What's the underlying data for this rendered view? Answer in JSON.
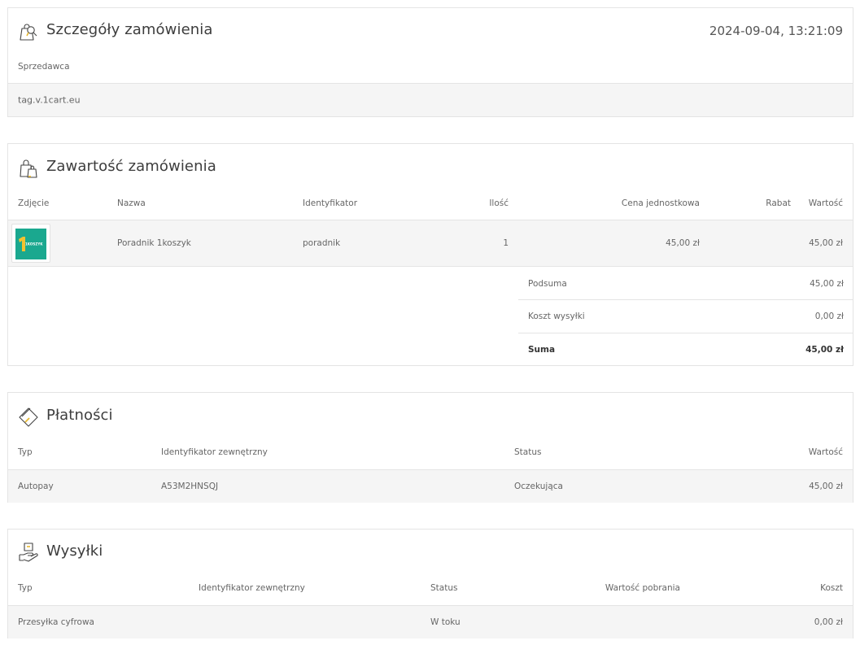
{
  "order_details": {
    "title": "Szczegóły zamówienia",
    "date": "2024-09-04, 13:21:09",
    "seller_label": "Sprzedawca",
    "seller_value": "tag.v.1cart.eu"
  },
  "contents": {
    "title": "Zawartość zamówienia",
    "columns": {
      "photo": "Zdjęcie",
      "name": "Nazwa",
      "identifier": "Identyfikator",
      "quantity": "Ilość",
      "unit_price": "Cena jednostkowa",
      "discount": "Rabat",
      "value": "Wartość"
    },
    "items": [
      {
        "thumb_text": "1KOSZYK",
        "name": "Poradnik 1koszyk",
        "identifier": "poradnik",
        "quantity": "1",
        "unit_price": "45,00 zł",
        "discount": "",
        "value": "45,00 zł"
      }
    ],
    "subtotal_label": "Podsuma",
    "subtotal_value": "45,00 zł",
    "shipping_label": "Koszt wysyłki",
    "shipping_value": "0,00 zł",
    "total_label": "Suma",
    "total_value": "45,00 zł"
  },
  "payments": {
    "title": "Płatności",
    "columns": {
      "type": "Typ",
      "external_id": "Identyfikator zewnętrzny",
      "status": "Status",
      "value": "Wartość"
    },
    "rows": [
      {
        "type": "Autopay",
        "external_id": "A53M2HNSQJ",
        "status": "Oczekująca",
        "value": "45,00 zł"
      }
    ]
  },
  "shipments": {
    "title": "Wysyłki",
    "columns": {
      "type": "Typ",
      "external_id": "Identyfikator zewnętrzny",
      "status": "Status",
      "cod_value": "Wartość pobrania",
      "cost": "Koszt"
    },
    "rows": [
      {
        "type": "Przesyłka cyfrowa",
        "external_id": "",
        "status": "W toku",
        "cod_value": "",
        "cost": "0,00 zł"
      }
    ]
  },
  "colors": {
    "border": "#e4e4e4",
    "row_bg": "#f5f5f5",
    "thumb_bg": "#1aa88f",
    "thumb_accent": "#f2c230"
  },
  "icons": {
    "order_details": "shopping-bag-search-icon",
    "contents": "shopping-bags-icon",
    "payments": "credit-card-icon",
    "shipments": "hand-package-icon"
  }
}
